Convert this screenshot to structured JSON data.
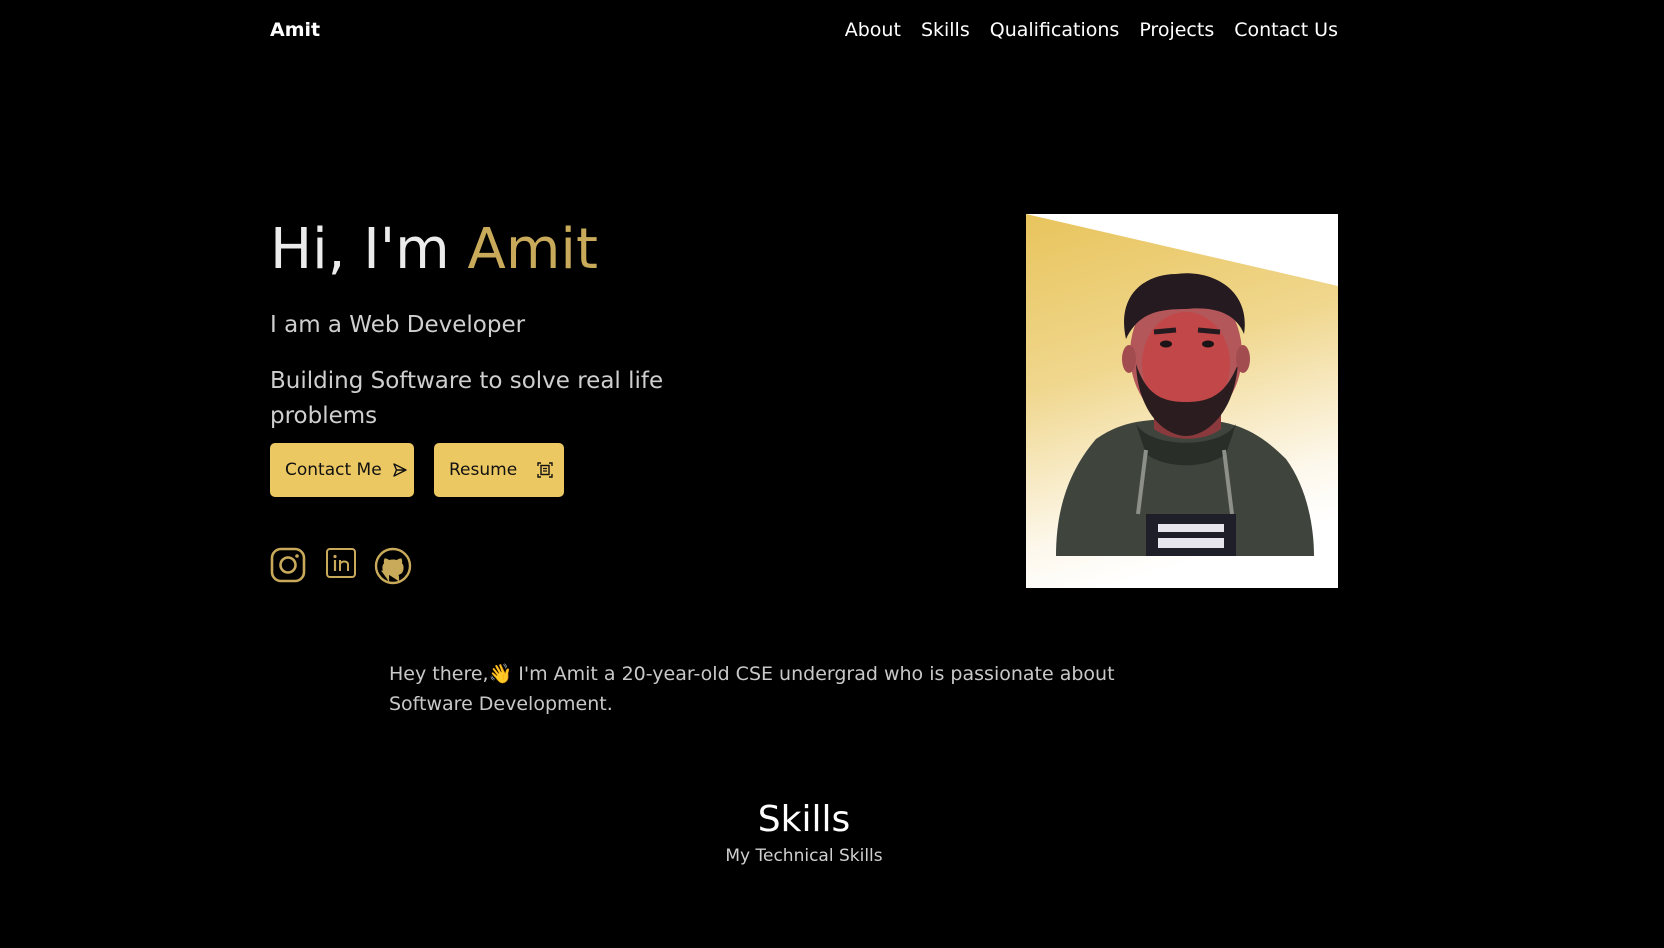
{
  "nav": {
    "brand": "Amit",
    "links": [
      "About",
      "Skills",
      "Qualifications",
      "Projects",
      "Contact Us"
    ]
  },
  "hero": {
    "greeting": "Hi, I'm ",
    "name": "Amit",
    "subtitle": "I am a Web Developer",
    "tagline": "Building Software to solve real life problems",
    "contact_button": "Contact Me",
    "contact_icon": "send-icon",
    "resume_button": "Resume",
    "resume_icon": "document-scan-icon",
    "social_icons": [
      "instagram-icon",
      "linkedin-icon",
      "github-icon"
    ]
  },
  "about": {
    "text": "Hey there,👋 I'm Amit a 20-year-old CSE undergrad who is passionate about Software Development."
  },
  "skills": {
    "title": "Skills",
    "subtitle": "My Technical Skills"
  },
  "colors": {
    "background": "#000000",
    "accent": "#c9aa5a",
    "button": "#ecc862",
    "text": "#ffffff"
  }
}
